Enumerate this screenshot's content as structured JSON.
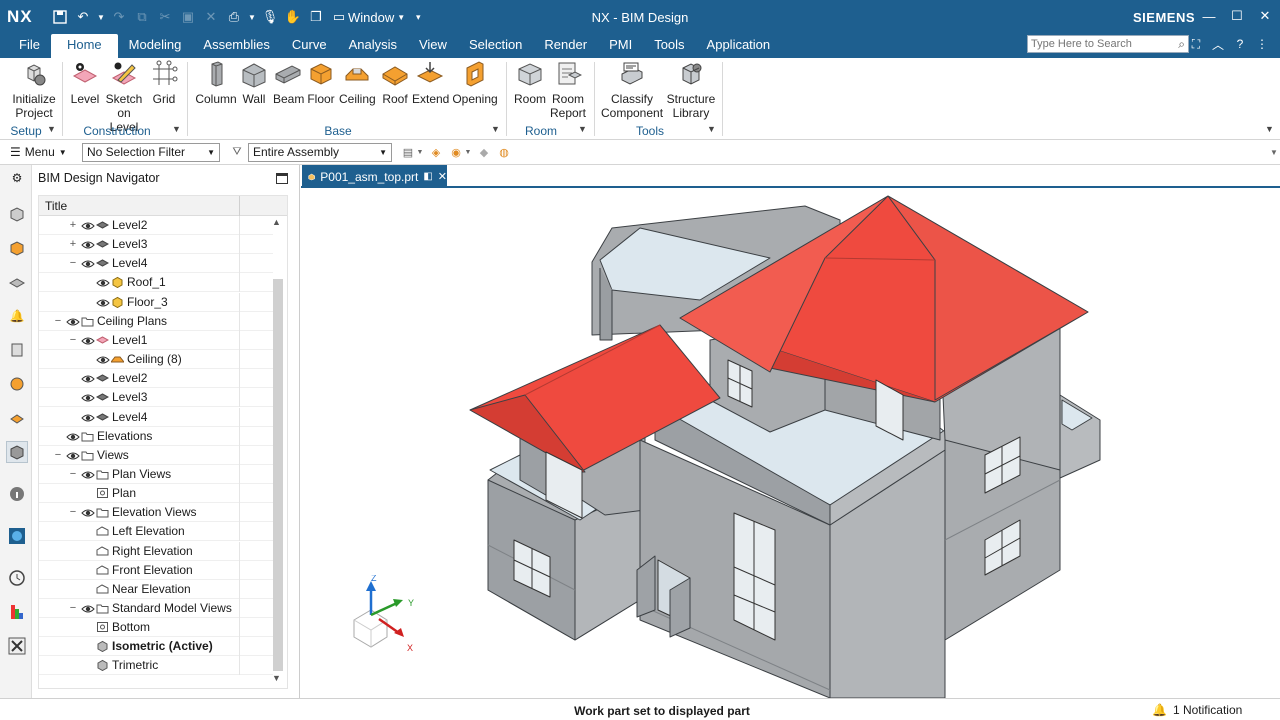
{
  "app": {
    "logo": "NX",
    "title": "NX - BIM Design",
    "brand": "SIEMENS",
    "window_menu": "Window"
  },
  "menu_tabs": [
    "File",
    "Home",
    "Modeling",
    "Assemblies",
    "Curve",
    "Analysis",
    "View",
    "Selection",
    "Render",
    "PMI",
    "Tools",
    "Application"
  ],
  "active_tab": "Home",
  "search": {
    "placeholder": "Type Here to Search"
  },
  "ribbon": {
    "commands": [
      {
        "label1": "Initialize",
        "label2": "Project",
        "icon": "initialize-project-icon"
      },
      {
        "label1": "Level",
        "label2": "",
        "icon": "level-icon"
      },
      {
        "label1": "Sketch",
        "label2": "on Level",
        "icon": "sketch-on-level-icon"
      },
      {
        "label1": "Grid",
        "label2": "",
        "icon": "grid-icon"
      },
      {
        "label1": "Column",
        "label2": "",
        "icon": "column-icon"
      },
      {
        "label1": "Wall",
        "label2": "",
        "icon": "wall-icon"
      },
      {
        "label1": "Beam",
        "label2": "",
        "icon": "beam-icon"
      },
      {
        "label1": "Floor",
        "label2": "",
        "icon": "floor-icon"
      },
      {
        "label1": "Ceiling",
        "label2": "",
        "icon": "ceiling-icon"
      },
      {
        "label1": "Roof",
        "label2": "",
        "icon": "roof-icon"
      },
      {
        "label1": "Extend",
        "label2": "",
        "icon": "extend-icon"
      },
      {
        "label1": "Opening",
        "label2": "",
        "icon": "opening-icon"
      },
      {
        "label1": "Room",
        "label2": "",
        "icon": "room-icon"
      },
      {
        "label1": "Room",
        "label2": "Report",
        "icon": "room-report-icon"
      },
      {
        "label1": "Classify",
        "label2": "Component",
        "icon": "classify-component-icon"
      },
      {
        "label1": "Structure",
        "label2": "Library",
        "icon": "structure-library-icon"
      }
    ],
    "groups": [
      "Setup",
      "Construction",
      "Base",
      "Room",
      "Tools"
    ]
  },
  "toolbar2": {
    "menu_label": "Menu",
    "selection_filter": "No Selection Filter",
    "scope": "Entire Assembly"
  },
  "navigator": {
    "title": "BIM Design Navigator",
    "column": "Title",
    "rows": [
      {
        "depth": 2,
        "toggle": "+",
        "label": "Level2",
        "icon": "level",
        "vis": true
      },
      {
        "depth": 2,
        "toggle": "+",
        "label": "Level3",
        "icon": "level",
        "vis": true
      },
      {
        "depth": 2,
        "toggle": "−",
        "label": "Level4",
        "icon": "level",
        "vis": true
      },
      {
        "depth": 3,
        "toggle": "",
        "label": "Roof_1",
        "icon": "cube",
        "vis": true
      },
      {
        "depth": 3,
        "toggle": "",
        "label": "Floor_3",
        "icon": "cube",
        "vis": true
      },
      {
        "depth": 1,
        "toggle": "−",
        "label": "Ceiling Plans",
        "icon": "folder",
        "vis": true
      },
      {
        "depth": 2,
        "toggle": "−",
        "label": "Level1",
        "icon": "level-pink",
        "vis": true
      },
      {
        "depth": 3,
        "toggle": "",
        "label": "Ceiling (8)",
        "icon": "ceiling",
        "vis": true
      },
      {
        "depth": 2,
        "toggle": "",
        "label": "Level2",
        "icon": "level",
        "vis": true
      },
      {
        "depth": 2,
        "toggle": "",
        "label": "Level3",
        "icon": "level",
        "vis": true
      },
      {
        "depth": 2,
        "toggle": "",
        "label": "Level4",
        "icon": "level",
        "vis": true
      },
      {
        "depth": 1,
        "toggle": "",
        "label": "Elevations",
        "icon": "folder",
        "vis": true
      },
      {
        "depth": 1,
        "toggle": "−",
        "label": "Views",
        "icon": "folder",
        "vis": true
      },
      {
        "depth": 2,
        "toggle": "−",
        "label": "Plan Views",
        "icon": "folder",
        "vis": true
      },
      {
        "depth": 3,
        "toggle": "",
        "label": "Plan",
        "icon": "view",
        "vis": false
      },
      {
        "depth": 2,
        "toggle": "−",
        "label": "Elevation Views",
        "icon": "folder",
        "vis": true
      },
      {
        "depth": 3,
        "toggle": "",
        "label": "Left Elevation",
        "icon": "elev",
        "vis": false
      },
      {
        "depth": 3,
        "toggle": "",
        "label": "Right Elevation",
        "icon": "elev",
        "vis": false
      },
      {
        "depth": 3,
        "toggle": "",
        "label": "Front Elevation",
        "icon": "elev",
        "vis": false
      },
      {
        "depth": 3,
        "toggle": "",
        "label": "Near Elevation",
        "icon": "elev",
        "vis": false
      },
      {
        "depth": 2,
        "toggle": "−",
        "label": "Standard Model Views",
        "icon": "folder",
        "vis": true
      },
      {
        "depth": 3,
        "toggle": "",
        "label": "Bottom",
        "icon": "view",
        "vis": false
      },
      {
        "depth": 3,
        "toggle": "",
        "label": "Isometric (Active)",
        "icon": "iso",
        "vis": false,
        "bold": true
      },
      {
        "depth": 3,
        "toggle": "",
        "label": "Trimetric",
        "icon": "iso",
        "vis": false
      }
    ]
  },
  "document_tab": "P001_asm_top.prt",
  "triad": {
    "z": "Z",
    "y": "Y",
    "x": "X"
  },
  "status": {
    "message": "Work part set to displayed part",
    "notification": "1 Notification"
  },
  "colors": {
    "primary": "#1e5f8f",
    "roof": "#ef4a3f",
    "wall": "#a9acaf",
    "slab": "#dce7ee"
  }
}
